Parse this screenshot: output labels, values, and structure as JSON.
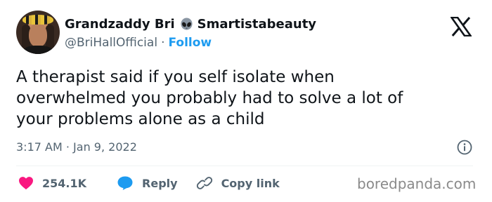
{
  "user": {
    "display_name": "Grandzaddy Bri",
    "name_suffix": "Smartistabeauty",
    "name_emoji_icon": "alien-icon",
    "handle": "@BriHallOfficial",
    "separator": "·",
    "follow_label": "Follow"
  },
  "platform_logo_icon": "x-logo-icon",
  "tweet": {
    "text_lines": [
      "A therapist said if you self isolate when",
      "overwhelmed you probably had to solve a lot of",
      "your problems alone as a child"
    ],
    "time": "3:17 AM",
    "date_separator": "·",
    "date": "Jan 9, 2022"
  },
  "actions": {
    "like_count": "254.1K",
    "reply_label": "Reply",
    "copy_link_label": "Copy link"
  },
  "watermark": "boredpanda.com",
  "colors": {
    "text": "#0f1419",
    "secondary": "#536471",
    "accent_blue": "#1d9bf0",
    "like_red": "#f91880",
    "divider": "#eff3f4"
  }
}
